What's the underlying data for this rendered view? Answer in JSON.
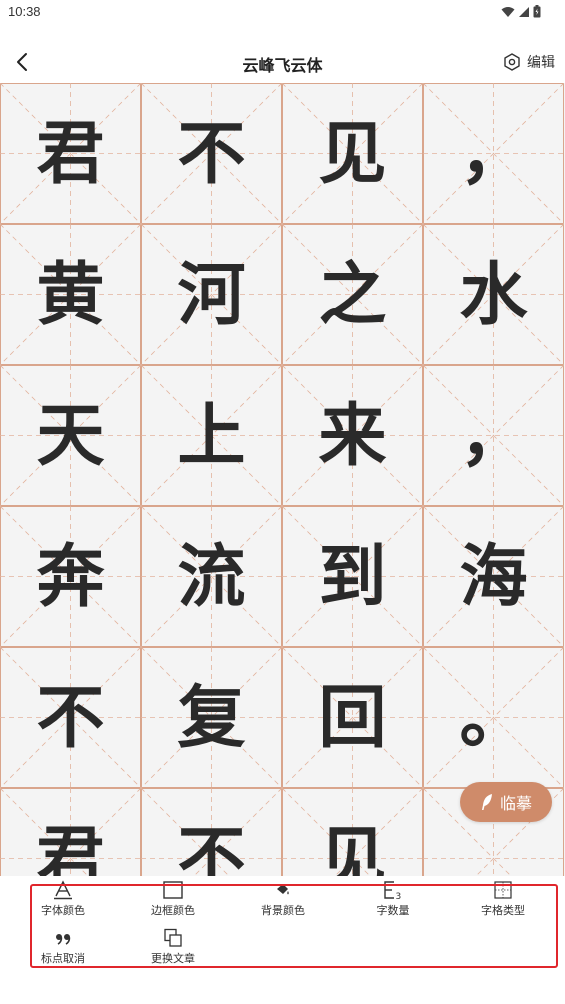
{
  "status_bar": {
    "time": "10:38"
  },
  "header": {
    "title": "云峰飞云体",
    "edit_label": "编辑"
  },
  "grid": {
    "characters": [
      "君",
      "不",
      "见",
      "，",
      "黄",
      "河",
      "之",
      "水",
      "天",
      "上",
      "来",
      "，",
      "奔",
      "流",
      "到",
      "海",
      "不",
      "复",
      "回",
      "。",
      "君",
      "不",
      "见"
    ]
  },
  "copy_button": {
    "label": "临摹"
  },
  "toolbar": {
    "items": [
      {
        "label": "字体颜色",
        "icon": "font-color-icon"
      },
      {
        "label": "边框颜色",
        "icon": "border-color-icon"
      },
      {
        "label": "背景颜色",
        "icon": "background-color-icon"
      },
      {
        "label": "字数量",
        "icon": "char-count-icon"
      },
      {
        "label": "字格类型",
        "icon": "grid-type-icon"
      },
      {
        "label": "标点取消",
        "icon": "punctuation-icon"
      },
      {
        "label": "更换文章",
        "icon": "change-article-icon"
      }
    ]
  },
  "colors": {
    "accent": "#cf8b6a",
    "grid_line": "#d9a58c",
    "guide_line": "#e2b39d",
    "highlight": "#e0262c",
    "background": "#f4f4f4"
  }
}
